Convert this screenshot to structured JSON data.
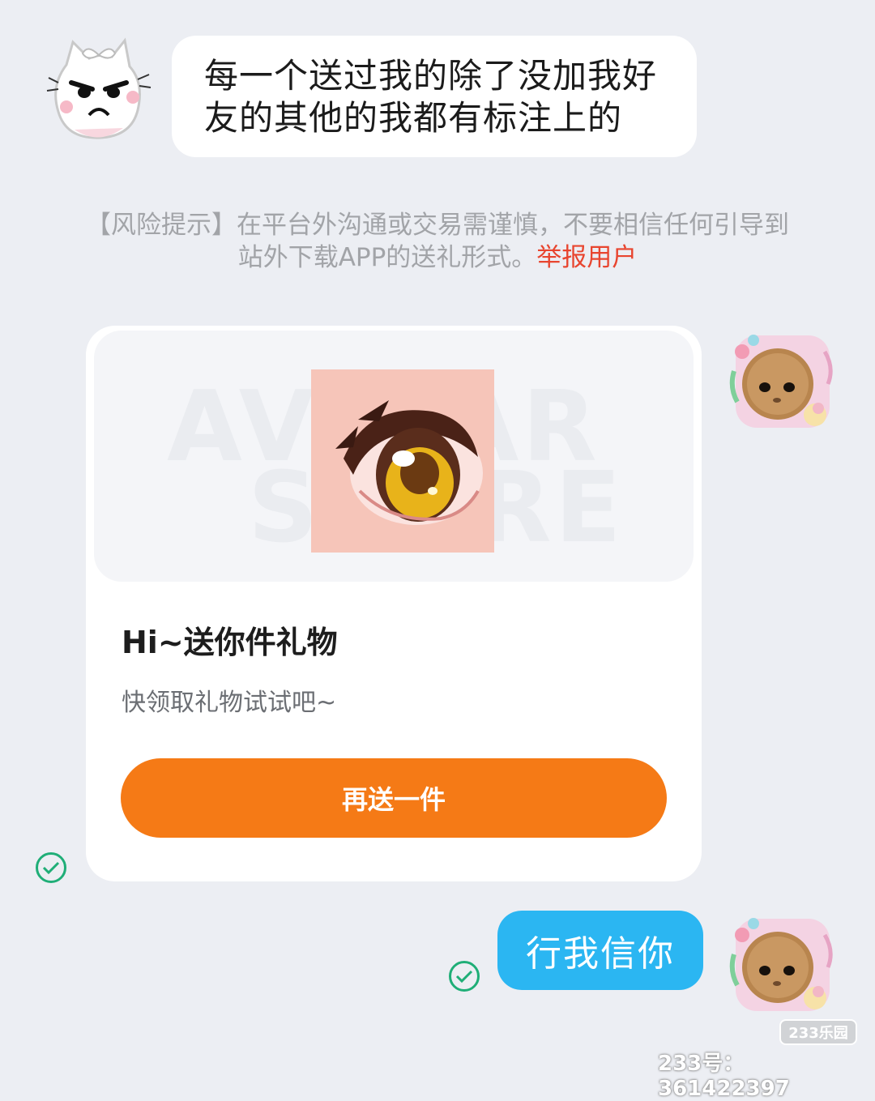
{
  "messages": {
    "incoming_text": "每一个送过我的除了没加我好友的其他的我都有标注上的",
    "incoming_line1": "每一个送过我的除了没加我好",
    "incoming_line2": "友的其他的我都有标注上的",
    "outgoing_text": "行我信你"
  },
  "risk_notice": {
    "line1": "【风险提示】在平台外沟通或交易需谨慎，不要相信任何引导到",
    "line2_prefix": "站外下载APP的送礼形式。",
    "report_link": "举报用户"
  },
  "gift_card": {
    "watermark_top": "AVATAR",
    "watermark_bottom": "STORE",
    "title": "Hi~送你件礼物",
    "subtitle": "快领取礼物试试吧~",
    "button_label": "再送一件"
  },
  "watermark": {
    "logo": "233乐园",
    "id_text": "233号：361422397"
  },
  "colors": {
    "background": "#eceef3",
    "accent_orange": "#f57a16",
    "outgoing_bubble": "#2bb6f2",
    "report_red": "#e8452f",
    "check_green": "#1fae77"
  },
  "icons": [
    "cat-sticker-avatar",
    "cat-photo-avatar",
    "check-circle-icon",
    "eye-gift-image"
  ]
}
